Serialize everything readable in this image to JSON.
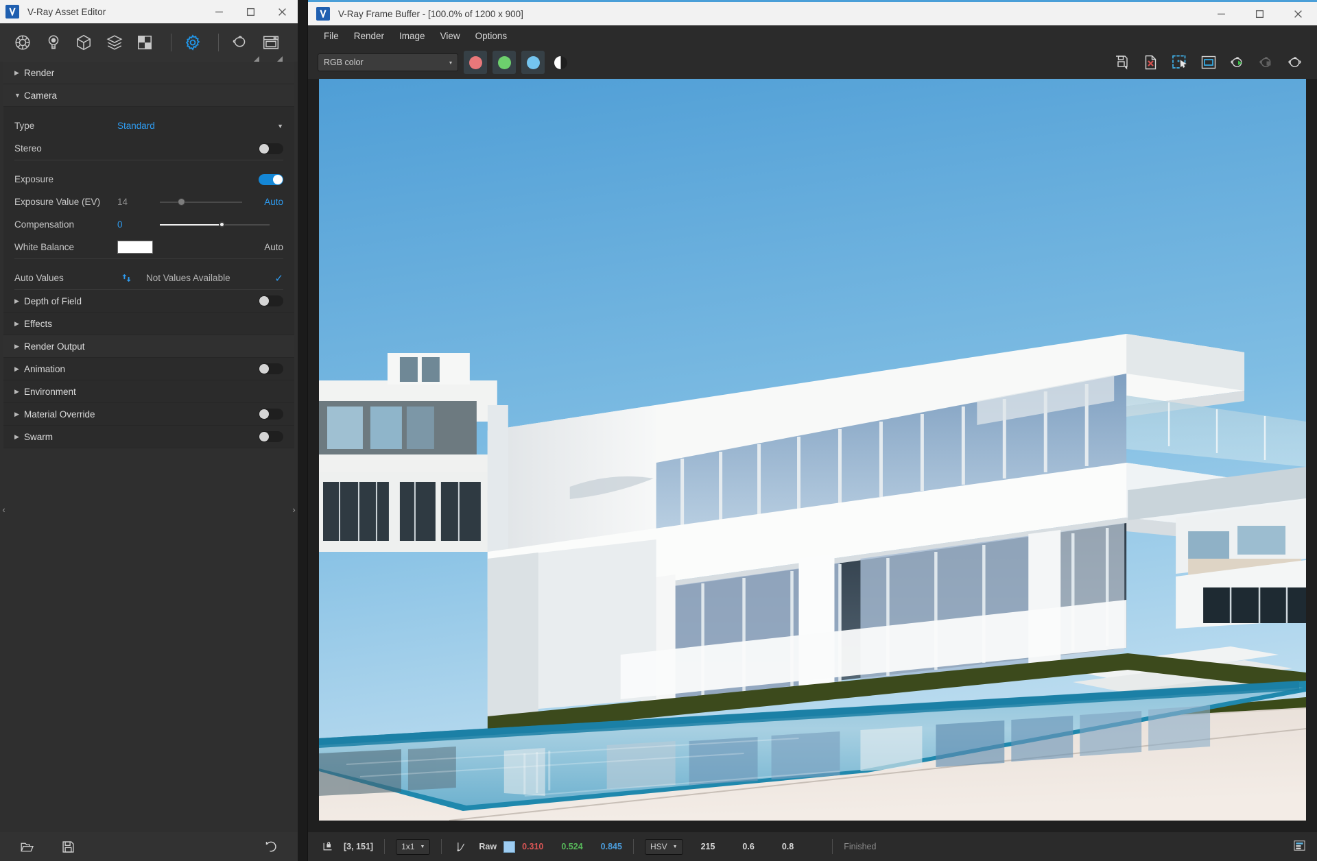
{
  "asset_editor": {
    "title": "V-Ray Asset Editor",
    "logo_icon": "vray-logo-icon",
    "window_buttons": {
      "minimize": "minimize-icon",
      "maximize": "maximize-icon",
      "close": "close-icon"
    },
    "toolbar": [
      {
        "name": "materials-icon",
        "label": "Materials"
      },
      {
        "name": "lights-icon",
        "label": "Lights"
      },
      {
        "name": "geometry-icon",
        "label": "Geometry"
      },
      {
        "name": "textures-icon",
        "label": "Textures"
      },
      {
        "name": "render-elements-icon",
        "label": "Render Elements"
      },
      {
        "name": "settings-gear-icon",
        "label": "Settings"
      },
      {
        "name": "teapot-render-icon",
        "label": "Render"
      },
      {
        "name": "frame-buffer-icon",
        "label": "Frame Buffer"
      }
    ],
    "sections": {
      "render": {
        "label": "Render",
        "expanded": false
      },
      "camera": {
        "label": "Camera",
        "expanded": true
      }
    },
    "camera": {
      "type": {
        "label": "Type",
        "value": "Standard"
      },
      "stereo": {
        "label": "Stereo",
        "on": false
      },
      "exposure": {
        "label": "Exposure",
        "on": true
      },
      "exposure_value": {
        "label": "Exposure Value (EV)",
        "value": "14",
        "auto": "Auto",
        "slider_pct": 22
      },
      "compensation": {
        "label": "Compensation",
        "value": "0",
        "slider_pct": 58
      },
      "white_balance": {
        "label": "White Balance",
        "color": "#ffffff",
        "auto": "Auto"
      },
      "auto_values": {
        "label": "Auto Values",
        "refresh_icon": "refresh-icon",
        "status": "Not Values Available",
        "check_icon": "check-icon"
      }
    },
    "collapsed_sections": [
      {
        "label": "Depth of Field",
        "toggle": true,
        "on": false
      },
      {
        "label": "Effects",
        "toggle": false
      },
      {
        "label": "Render Output",
        "toggle": false
      },
      {
        "label": "Animation",
        "toggle": true,
        "on": false
      },
      {
        "label": "Environment",
        "toggle": false
      },
      {
        "label": "Material Override",
        "toggle": true,
        "on": false
      },
      {
        "label": "Swarm",
        "toggle": true,
        "on": false
      }
    ],
    "footer": {
      "open": "open-folder-icon",
      "save": "save-disk-icon",
      "revert": "revert-undo-icon"
    },
    "handles": {
      "left": "‹",
      "right": "›"
    }
  },
  "frame_buffer": {
    "title": "V-Ray Frame Buffer - [100.0% of 1200 x 900]",
    "logo_icon": "vray-logo-icon",
    "window_buttons": {
      "minimize": "minimize-icon",
      "maximize": "maximize-icon",
      "close": "close-icon"
    },
    "menus": [
      "File",
      "Render",
      "Image",
      "View",
      "Options"
    ],
    "toolbar": {
      "channel_select": {
        "value": "RGB color",
        "arrow": "▾"
      },
      "channel_buttons": [
        {
          "name": "red-channel-button",
          "color": "#e8787a"
        },
        {
          "name": "green-channel-button",
          "color": "#6dd06d"
        },
        {
          "name": "blue-channel-button",
          "color": "#74c5f0"
        }
      ],
      "alpha_button": {
        "name": "alpha-channel-button"
      },
      "right_icons": [
        {
          "name": "save-image-icon"
        },
        {
          "name": "clear-image-icon"
        },
        {
          "name": "region-render-icon"
        },
        {
          "name": "show-render-frame-icon",
          "accent": "#35a8e0"
        },
        {
          "name": "start-render-icon",
          "accent": "#3cc24a"
        },
        {
          "name": "stop-render-icon",
          "dim": true
        },
        {
          "name": "teapot-icon"
        }
      ]
    },
    "status_bar": {
      "pixel_lock_icon": "pixel-lock-icon",
      "coordinates": "[3, 151]",
      "sampling": "1x1",
      "curve_icon": "color-curve-icon",
      "mode": "Raw",
      "swatch_color": "#9ecdf2",
      "r": "0.310",
      "g": "0.524",
      "b": "0.845",
      "color_space": "HSV",
      "h": "215",
      "s": "0.6",
      "v": "0.8",
      "state": "Finished",
      "panel_icon": "layers-panel-icon"
    },
    "render_preview": {
      "description": "Modern white concrete villa with large glass facade and reflecting swimming pool under clear blue sky",
      "sky_top": "#4f9ed6",
      "sky_bottom": "#b9dcf0",
      "concrete": "#f4f4f2",
      "pool_water": "#7fbfdc",
      "pool_tile": "#1f88ad",
      "deck": "#efe9e3",
      "grass": "#3c4a1c"
    }
  }
}
